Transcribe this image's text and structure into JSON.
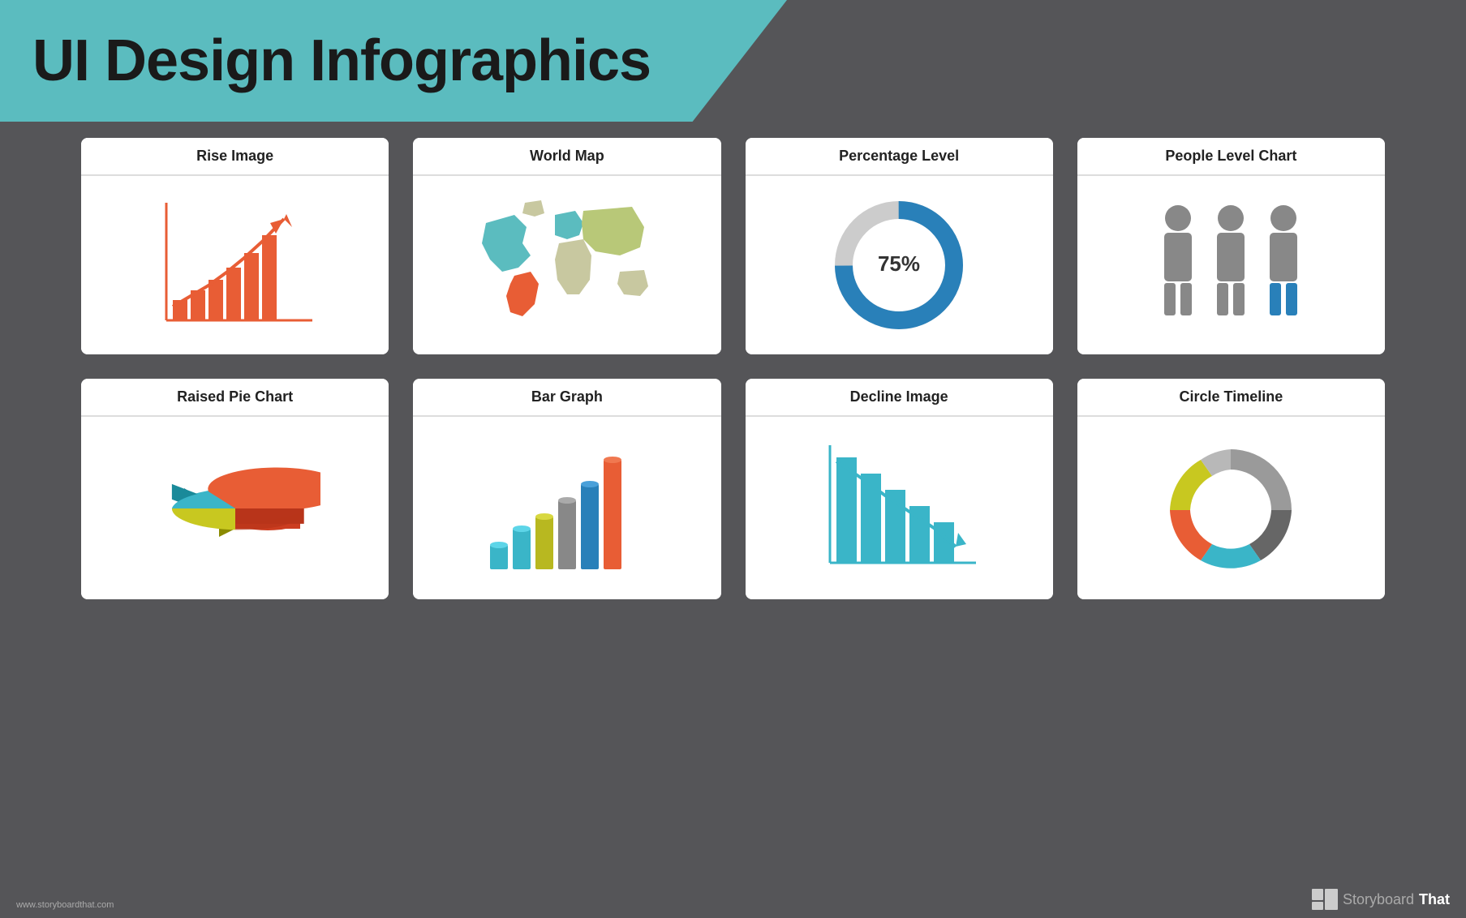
{
  "header": {
    "title": "UI Design Infographics",
    "bg_color": "#5bbcbf"
  },
  "cards": [
    {
      "id": "rise-image",
      "title": "Rise Image"
    },
    {
      "id": "world-map",
      "title": "World Map"
    },
    {
      "id": "percentage-level",
      "title": "Percentage Level"
    },
    {
      "id": "people-level-chart",
      "title": "People Level Chart"
    },
    {
      "id": "raised-pie-chart",
      "title": "Raised Pie Chart"
    },
    {
      "id": "bar-graph",
      "title": "Bar Graph"
    },
    {
      "id": "decline-image",
      "title": "Decline Image"
    },
    {
      "id": "circle-timeline",
      "title": "Circle Timeline"
    }
  ],
  "percentage": "75%",
  "footer": {
    "website": "www.storyboardthat.com",
    "brand": "StoryboardThat"
  }
}
